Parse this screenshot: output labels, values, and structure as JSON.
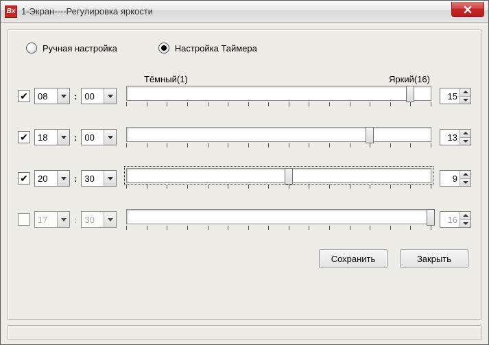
{
  "window": {
    "title": "1-Экран----Регулировка яркости",
    "app_icon_text": "Bx"
  },
  "radios": {
    "manual": "Ручная настройка",
    "timer": "Настройка Таймера",
    "selected": "timer"
  },
  "slider_labels": {
    "dark": "Тёмный(1)",
    "bright": "Яркий(16)"
  },
  "rows": [
    {
      "enabled": true,
      "hour": "08",
      "minute": "00",
      "value": 15,
      "focused": false
    },
    {
      "enabled": true,
      "hour": "18",
      "minute": "00",
      "value": 13,
      "focused": false
    },
    {
      "enabled": true,
      "hour": "20",
      "minute": "30",
      "value": 9,
      "focused": true
    },
    {
      "enabled": false,
      "hour": "17",
      "minute": "30",
      "value": 16,
      "focused": false
    }
  ],
  "buttons": {
    "save": "Сохранить",
    "close": "Закрыть"
  },
  "slider": {
    "min": 1,
    "max": 16
  }
}
